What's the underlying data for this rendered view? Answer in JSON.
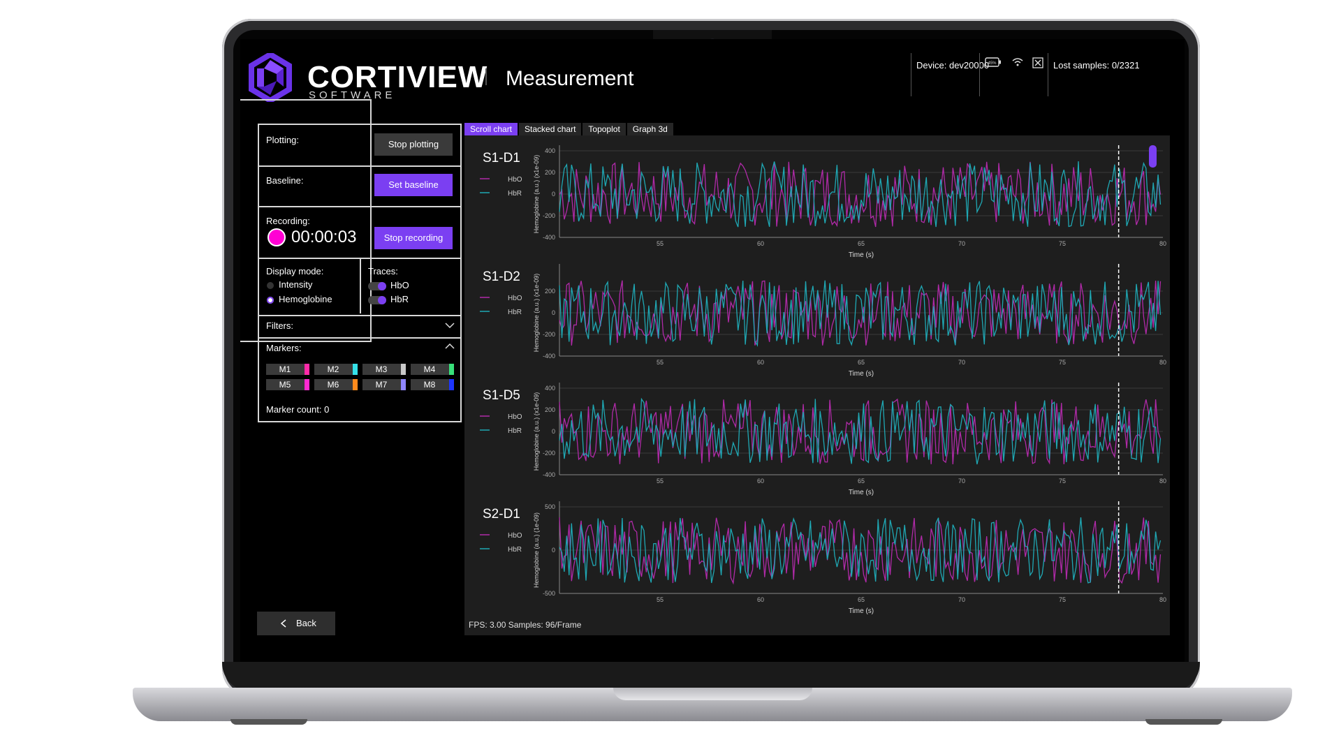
{
  "header": {
    "brand": "CORTIVIEW",
    "brand_sub": "SOFTWARE",
    "page_title": "Measurement",
    "device_label": "Device: dev20000",
    "battery": "45%",
    "lost_samples": "Lost samples: 0/2321"
  },
  "controls": {
    "plotting_label": "Plotting:",
    "plotting_button": "Stop plotting",
    "baseline_label": "Baseline:",
    "baseline_button": "Set baseline",
    "recording_label": "Recording:",
    "recording_time": "00:00:03",
    "recording_button": "Stop recording",
    "display_mode_label": "Display mode:",
    "display_modes": [
      "Intensity",
      "Hemoglobine"
    ],
    "display_mode_selected": "Hemoglobine",
    "traces_label": "Traces:",
    "traces": [
      "HbO",
      "HbR"
    ],
    "filters_label": "Filters:",
    "markers_label": "Markers:",
    "markers": [
      {
        "label": "M1",
        "color": "#ff2aa8"
      },
      {
        "label": "M2",
        "color": "#35e0e8"
      },
      {
        "label": "M3",
        "color": "#c8c8c8"
      },
      {
        "label": "M4",
        "color": "#38e07a"
      },
      {
        "label": "M5",
        "color": "#ff2ad0"
      },
      {
        "label": "M6",
        "color": "#ff8a1c"
      },
      {
        "label": "M7",
        "color": "#8f86ff"
      },
      {
        "label": "M8",
        "color": "#1d35ff"
      }
    ],
    "marker_count": "Marker count: 0",
    "back_button": "Back"
  },
  "tabs": [
    "Scroll chart",
    "Stacked chart",
    "Topoplot",
    "Graph 3d"
  ],
  "active_tab": "Scroll chart",
  "status_bar": "FPS: 3.00 Samples: 96/Frame",
  "colors": {
    "accent": "#7b3ff2",
    "hbo": "#b02aa8",
    "hbr": "#1fa8b4"
  },
  "chart_data": [
    {
      "type": "line",
      "title": "S1-D1",
      "xlabel": "Time (s)",
      "ylabel": "Hemoglobine (a.u.) (x1e-09)",
      "xlim": [
        50,
        80
      ],
      "ylim": [
        -400,
        400
      ],
      "yticks": [
        -400,
        -200,
        0,
        200,
        400
      ],
      "xticks": [
        55,
        60,
        65,
        70,
        75,
        80
      ],
      "marker_time": 77.8,
      "series": [
        {
          "name": "HbO"
        },
        {
          "name": "HbR"
        }
      ]
    },
    {
      "type": "line",
      "title": "S1-D2",
      "xlabel": "Time (s)",
      "ylabel": "Hemoglobine (a.u.) (x1e-09)",
      "xlim": [
        50,
        80
      ],
      "ylim": [
        -400,
        400
      ],
      "yticks": [
        -400,
        -200,
        0,
        200
      ],
      "xticks": [
        55,
        60,
        65,
        70,
        75,
        80
      ],
      "marker_time": 77.8,
      "series": [
        {
          "name": "HbO"
        },
        {
          "name": "HbR"
        }
      ]
    },
    {
      "type": "line",
      "title": "S1-D5",
      "xlabel": "Time (s)",
      "ylabel": "Hemoglobine (a.u.) (x1e-09)",
      "xlim": [
        50,
        80
      ],
      "ylim": [
        -400,
        400
      ],
      "yticks": [
        -400,
        -200,
        0,
        200,
        400
      ],
      "xticks": [
        55,
        60,
        65,
        70,
        75,
        80
      ],
      "marker_time": 77.8,
      "series": [
        {
          "name": "HbO"
        },
        {
          "name": "HbR"
        }
      ]
    },
    {
      "type": "line",
      "title": "S2-D1",
      "xlabel": "Time (s)",
      "ylabel": "Hemoglobine (a.u.) (1e-09)",
      "xlim": [
        50,
        80
      ],
      "ylim": [
        -500,
        500
      ],
      "yticks": [
        -500,
        0,
        500
      ],
      "xticks": [
        55,
        60,
        65,
        70,
        75,
        80
      ],
      "marker_time": 77.8,
      "series": [
        {
          "name": "HbO"
        },
        {
          "name": "HbR"
        }
      ]
    }
  ]
}
